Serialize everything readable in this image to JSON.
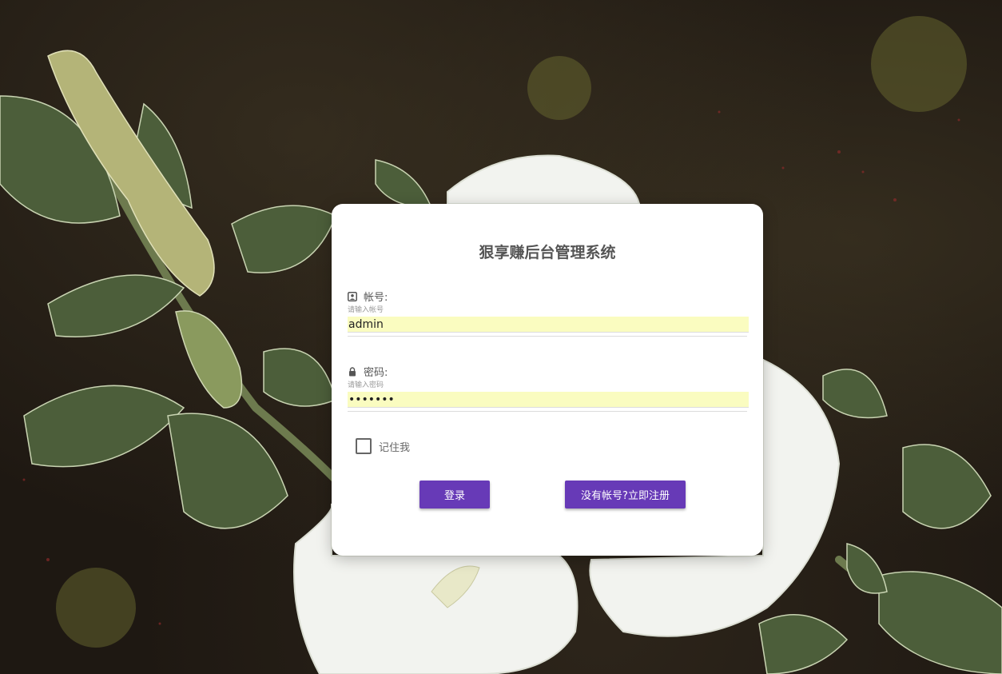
{
  "login": {
    "title": "狠享赚后台管理系统",
    "username": {
      "label": "帐号:",
      "hint": "请输入帐号",
      "value": "admin",
      "icon": "user-card-icon"
    },
    "password": {
      "label": "密码:",
      "hint": "请输入密码",
      "value": "•••••••",
      "icon": "lock-icon"
    },
    "remember_label": "记住我",
    "remember_checked": false,
    "login_button": "登录",
    "register_button": "没有帐号?立即注册"
  },
  "colors": {
    "accent": "#673ab7",
    "autofill": "#fafcc0",
    "card": "#ffffff"
  }
}
